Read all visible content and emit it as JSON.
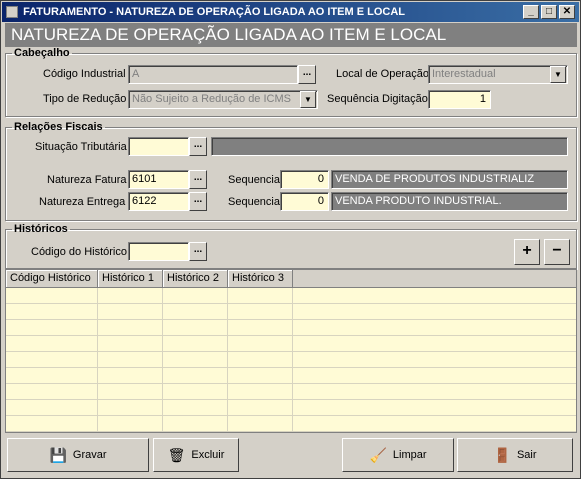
{
  "window": {
    "title": "FATURAMENTO - NATUREZA DE OPERAÇÃO LIGADA AO ITEM E LOCAL",
    "min": "_",
    "max": "□",
    "close": "✕"
  },
  "header": {
    "title": "NATUREZA DE OPERAÇÃO LIGADA AO ITEM E LOCAL"
  },
  "cabecalho": {
    "legend": "Cabeçalho",
    "codigo_label": "Código Industrial",
    "codigo_value": "A",
    "local_label": "Local de Operação",
    "local_value": "Interestadual",
    "tipo_label": "Tipo de Redução",
    "tipo_value": "Não Sujeito a Redução de ICMS",
    "seq_label": "Sequência Digitação",
    "seq_value": "1"
  },
  "fiscais": {
    "legend": "Relações Fiscais",
    "situacao_label": "Situação Tributária",
    "situacao_value": "",
    "fatura_label": "Natureza Fatura",
    "fatura_value": "6101",
    "fatura_seq_label": "Sequencia",
    "fatura_seq_value": "0",
    "fatura_desc": "VENDA DE PRODUTOS INDUSTRIALIZ",
    "entrega_label": "Natureza Entrega",
    "entrega_value": "6122",
    "entrega_seq_label": "Sequencia",
    "entrega_seq_value": "0",
    "entrega_desc": "VENDA PRODUTO INDUSTRIAL."
  },
  "historicos": {
    "legend": "Históricos",
    "codigo_label": "Código do Histórico",
    "codigo_value": "",
    "add": "+",
    "remove": "−",
    "columns": [
      "Código Histórico",
      "Histórico 1",
      "Histórico 2",
      "Histórico 3"
    ]
  },
  "buttons": {
    "gravar": "Gravar",
    "excluir": "Excluir",
    "limpar": "Limpar",
    "sair": "Sair"
  },
  "dots": "..."
}
